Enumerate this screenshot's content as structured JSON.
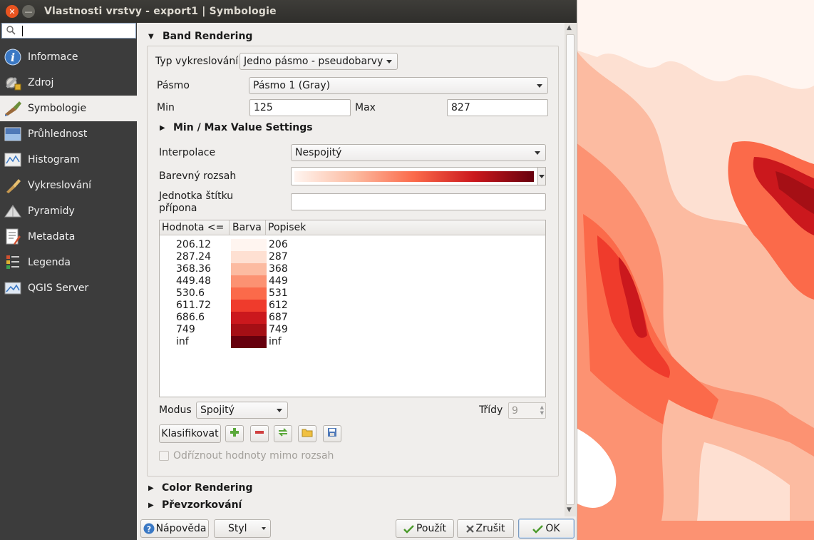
{
  "window": {
    "title": "Vlastnosti vrstvy - export1 | Symbologie"
  },
  "search": {
    "placeholder": ""
  },
  "sidebar": {
    "items": [
      {
        "label": "Informace",
        "icon": "info-icon"
      },
      {
        "label": "Zdroj",
        "icon": "source-icon"
      },
      {
        "label": "Symbologie",
        "icon": "paintbrush-icon",
        "active": true
      },
      {
        "label": "Průhlednost",
        "icon": "transparency-icon"
      },
      {
        "label": "Histogram",
        "icon": "histogram-icon"
      },
      {
        "label": "Vykreslování",
        "icon": "rendering-icon"
      },
      {
        "label": "Pyramidy",
        "icon": "pyramid-icon"
      },
      {
        "label": "Metadata",
        "icon": "metadata-icon"
      },
      {
        "label": "Legenda",
        "icon": "legend-icon"
      },
      {
        "label": "QGIS Server",
        "icon": "server-icon"
      }
    ]
  },
  "band_rendering": {
    "header": "Band Rendering",
    "render_type_label": "Typ vykreslování",
    "render_type_value": "Jedno pásmo - pseudobarvy",
    "band_label": "Pásmo",
    "band_value": "Pásmo 1 (Gray)",
    "min_label": "Min",
    "min_value": "125",
    "max_label": "Max",
    "max_value": "827",
    "minmax_settings": "Min / Max Value Settings",
    "interp_label": "Interpolace",
    "interp_value": "Nespojitý",
    "ramp_label": "Barevný rozsah",
    "ramp_colors": [
      "#fff5f0",
      "#fcbba1",
      "#fb6a4a",
      "#cb181d",
      "#67000d"
    ],
    "unit_label_1": "Jednotka štítku",
    "unit_label_2": "přípona",
    "unit_value": "",
    "table": {
      "headers": [
        "Hodnota <=",
        "Barva",
        "Popisek"
      ],
      "rows": [
        {
          "value": "206.12",
          "color": "#fff5f0",
          "label": "206"
        },
        {
          "value": "287.24",
          "color": "#fee0d2",
          "label": "287"
        },
        {
          "value": "368.36",
          "color": "#fcbba1",
          "label": "368"
        },
        {
          "value": "449.48",
          "color": "#fc9272",
          "label": "449"
        },
        {
          "value": "530.6",
          "color": "#fb6a4a",
          "label": "531"
        },
        {
          "value": "611.72",
          "color": "#ef3b2c",
          "label": "612"
        },
        {
          "value": "686.6",
          "color": "#cb181d",
          "label": "687"
        },
        {
          "value": "749",
          "color": "#a50f15",
          "label": "749"
        },
        {
          "value": "inf",
          "color": "#67000d",
          "label": "inf"
        }
      ]
    },
    "mode_label": "Modus",
    "mode_value": "Spojitý",
    "classes_label": "Třídy",
    "classes_value": "9",
    "classify_button": "Klasifikovat",
    "clip_label": "Odříznout hodnoty mimo rozsah"
  },
  "sections": {
    "color_rendering": "Color Rendering",
    "resampling": "Převzorkování"
  },
  "footer": {
    "help": "Nápověda",
    "style": "Styl",
    "apply": "Použít",
    "cancel": "Zrušit",
    "ok": "OK"
  }
}
